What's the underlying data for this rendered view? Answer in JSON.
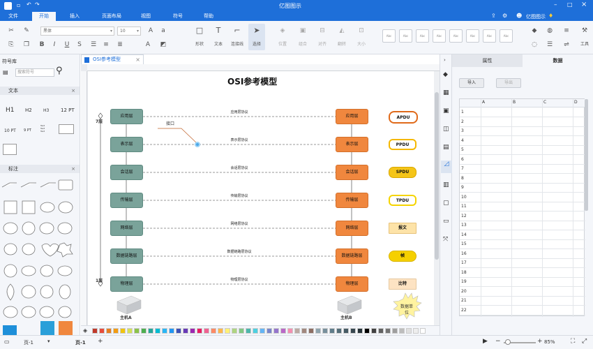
{
  "app": {
    "title": "亿图图示",
    "user": "亿图图示"
  },
  "menu": {
    "items": [
      "文件",
      "开始",
      "插入",
      "页面布局",
      "视图",
      "符号",
      "帮助"
    ],
    "active": "开始"
  },
  "ribbon": {
    "font_name": "黑体",
    "font_size": "10",
    "shape_label": "形状",
    "text_label": "文本",
    "connector_label": "连接线",
    "select_label": "选择",
    "position_label": "位置",
    "group_label": "组合",
    "align_label": "对齐",
    "flip_label": "翻转",
    "size_label": "大小",
    "tools_label": "工具",
    "style_label": "Abc"
  },
  "left_panel": {
    "title": "符号库",
    "search_placeholder": "搜索符号",
    "section1": "文本",
    "section2": "标注",
    "text_samples": [
      "H1",
      "H2",
      "H3",
      "12 PT",
      "10 PT",
      "9 PT"
    ]
  },
  "doc": {
    "tab": "OSI参考模型"
  },
  "diagram": {
    "title": "OSI参考模型",
    "interface_label": "接口",
    "layer7_label": "7层",
    "layer1_label": "1层",
    "hostA": "主机A",
    "hostB": "主机B",
    "layers": [
      "应用层",
      "表示层",
      "会话层",
      "传输层",
      "网络层",
      "数据链路层",
      "物理层"
    ],
    "protocols": [
      "应用层协议",
      "表示层协议",
      "会话层协议",
      "传输层协议",
      "网络层协议",
      "数据链路层协议",
      "物理层协议"
    ],
    "pdus": [
      "APDU",
      "PPDU",
      "SPDU",
      "TPDU",
      "报文",
      "帧",
      "比特"
    ],
    "data_unit": "数据单位"
  },
  "right_panel": {
    "tab_props": "属性",
    "tab_data": "数据",
    "import": "导入",
    "export": "导出",
    "columns": [
      "A",
      "B",
      "C",
      "D"
    ],
    "rows": [
      "1",
      "2",
      "3",
      "4",
      "5",
      "6",
      "7",
      "8",
      "9",
      "10",
      "11",
      "12",
      "13",
      "14",
      "15",
      "16",
      "17",
      "18",
      "19",
      "20",
      "21",
      "22"
    ]
  },
  "status": {
    "page_selector": "页-1",
    "page_tab": "页-1",
    "add": "+",
    "zoom": "85%"
  },
  "colors": {
    "brand": "#1e6fd9",
    "layerA": "#7aa39a",
    "layerB": "#f0873e"
  }
}
